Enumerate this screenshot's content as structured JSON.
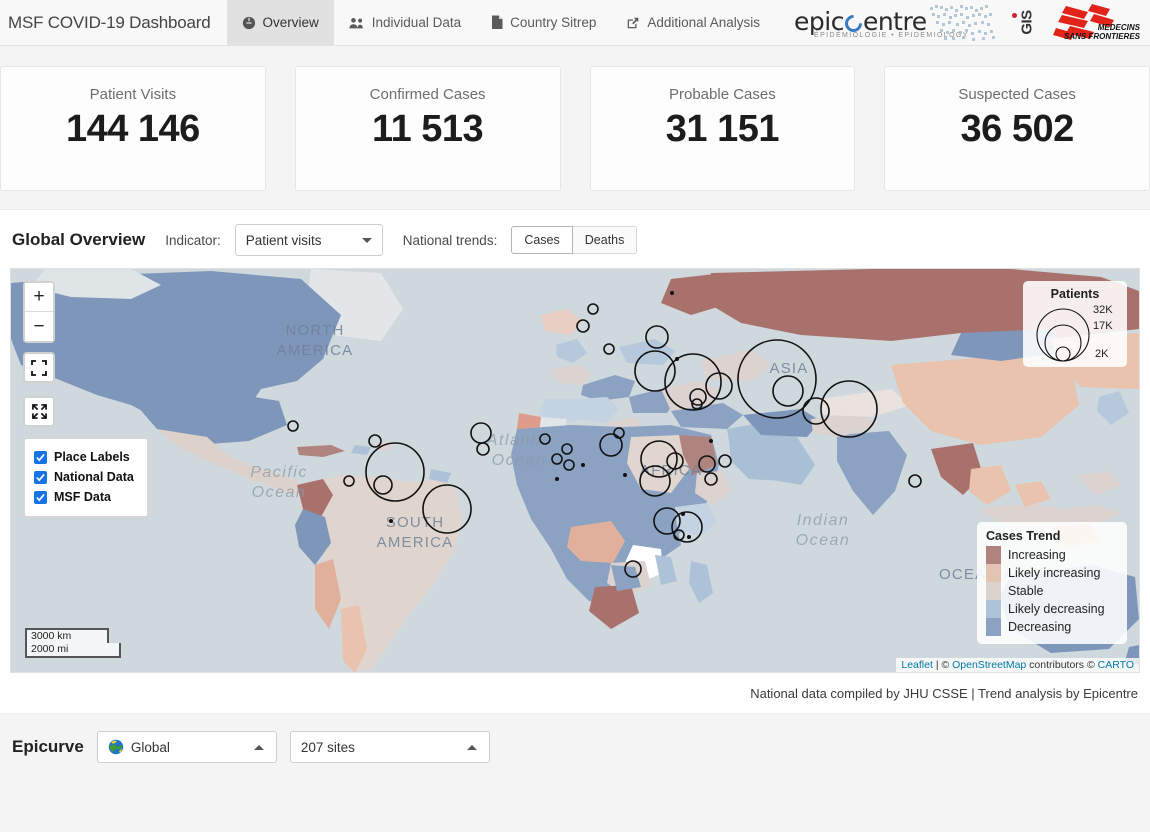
{
  "navbar": {
    "brand": "MSF COVID-19 Dashboard",
    "tabs": [
      {
        "label": "Overview",
        "icon": "globe-icon",
        "active": true
      },
      {
        "label": "Individual Data",
        "icon": "users-icon",
        "active": false
      },
      {
        "label": "Country Sitrep",
        "icon": "file-icon",
        "active": false
      },
      {
        "label": "Additional Analysis",
        "icon": "external-link-icon",
        "active": false
      }
    ],
    "logos": {
      "epicentre_word": "epicentre",
      "epicentre_sub": "ÉPIDÉMIOLOGIE  •  EPIDEMIOLOGY",
      "gis_label": "GIS",
      "msf_line1": "MEDECINS",
      "msf_line2": "SANS FRONTIERES"
    }
  },
  "stat_cards": [
    {
      "label": "Patient Visits",
      "value": "144 146"
    },
    {
      "label": "Confirmed Cases",
      "value": "11 513"
    },
    {
      "label": "Probable Cases",
      "value": "31 151"
    },
    {
      "label": "Suspected Cases",
      "value": "36 502"
    }
  ],
  "global_overview": {
    "title": "Global Overview",
    "indicator_label": "Indicator:",
    "indicator_value": "Patient visits",
    "national_trends_label": "National trends:",
    "trend_buttons": [
      {
        "label": "Cases",
        "active": true
      },
      {
        "label": "Deaths",
        "active": false
      }
    ],
    "footer_note": "National data compiled by JHU CSSE | Trend analysis by Epicentre"
  },
  "map": {
    "zoom_in": "+",
    "zoom_out": "−",
    "layers": [
      {
        "label": "Place Labels",
        "checked": true
      },
      {
        "label": "National Data",
        "checked": true
      },
      {
        "label": "MSF Data",
        "checked": true
      }
    ],
    "scale": {
      "metric": "3000 km",
      "imperial": "2000 mi"
    },
    "patients_legend": {
      "title": "Patients",
      "sizes": [
        {
          "label": "32K",
          "value": 32000
        },
        {
          "label": "17K",
          "value": 17000
        },
        {
          "label": "2K",
          "value": 2000
        }
      ]
    },
    "trend_legend": {
      "title": "Cases Trend",
      "items": [
        {
          "label": "Increasing",
          "color": "#b0847e"
        },
        {
          "label": "Likely increasing",
          "color": "#e3c3b2"
        },
        {
          "label": "Stable",
          "color": "#dcd3d0"
        },
        {
          "label": "Likely decreasing",
          "color": "#acc3d8"
        },
        {
          "label": "Decreasing",
          "color": "#8ba2c2"
        }
      ]
    },
    "ocean_labels": [
      "Pacific\nOcean",
      "Atlantic\nOcean",
      "Indian\nOcean"
    ],
    "continent_labels": [
      "NORTH AMERICA",
      "SOUTH AMERICA",
      "AFRICA",
      "ASIA",
      "OCEANIA"
    ],
    "attribution": {
      "leaflet": "Leaflet",
      "sep1": " | © ",
      "osm": "OpenStreetMap",
      "mid": " contributors © ",
      "carto": "CARTO"
    }
  },
  "epicurve": {
    "title": "Epicurve",
    "scope_value": "Global",
    "sites_value": "207 sites"
  }
}
